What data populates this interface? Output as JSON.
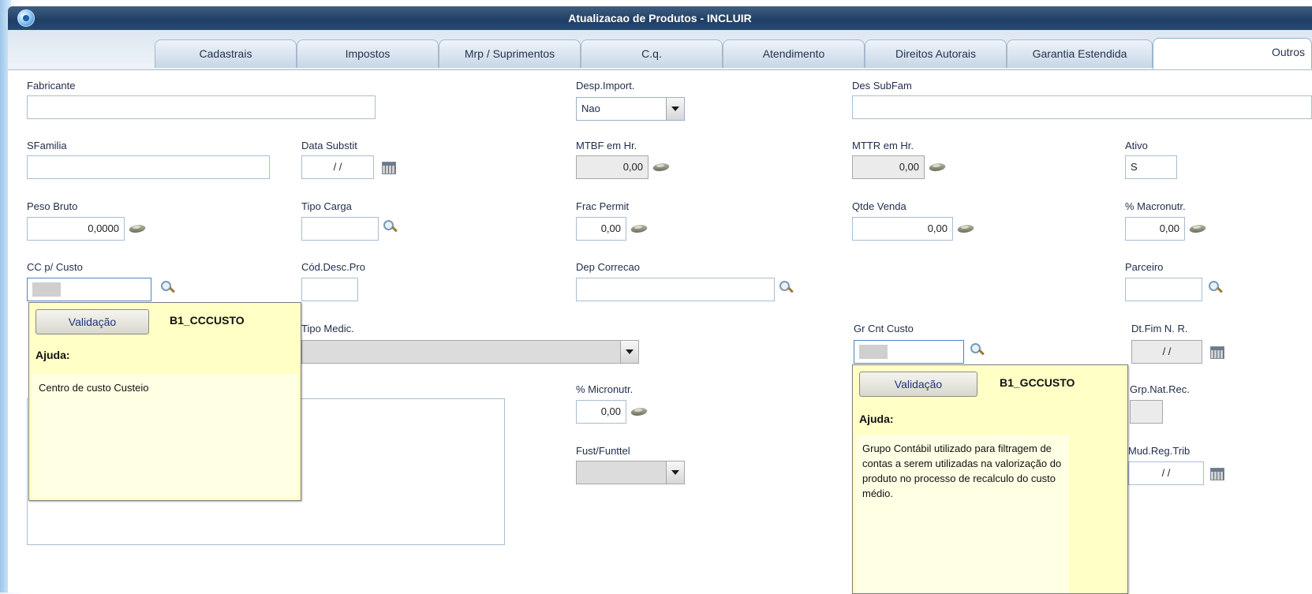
{
  "window": {
    "title": "Atualizacao de Produtos - INCLUIR"
  },
  "tabs": [
    "Cadastrais",
    "Impostos",
    "Mrp / Suprimentos",
    "C.q.",
    "Atendimento",
    "Direitos Autorais",
    "Garantia Estendida",
    "Outros"
  ],
  "active_tab": "Outros",
  "fields": {
    "fabricante": {
      "label": "Fabricante",
      "value": ""
    },
    "desp_import": {
      "label": "Desp.Import.",
      "value": "Nao"
    },
    "des_subfam": {
      "label": "Des SubFam",
      "value": ""
    },
    "sfamilia": {
      "label": "SFamilia",
      "value": ""
    },
    "data_substit": {
      "label": "Data Substit",
      "value": " / /"
    },
    "mtbf": {
      "label": "MTBF em Hr.",
      "value": "0,00"
    },
    "mttr": {
      "label": "MTTR em Hr.",
      "value": "0,00"
    },
    "ativo": {
      "label": "Ativo",
      "value": "S"
    },
    "peso_bruto": {
      "label": "Peso Bruto",
      "value": "0,0000"
    },
    "tipo_carga": {
      "label": "Tipo Carga",
      "value": ""
    },
    "frac_permit": {
      "label": "Frac Permit",
      "value": "0,00"
    },
    "qtde_venda": {
      "label": "Qtde Venda",
      "value": "0,00"
    },
    "macronutr": {
      "label": "% Macronutr.",
      "value": "0,00"
    },
    "cc_custo": {
      "label": "CC p/ Custo",
      "value": ""
    },
    "cod_desc_pro": {
      "label": "Cód.Desc.Pro",
      "value": ""
    },
    "dep_correcao": {
      "label": "Dep Correcao",
      "value": ""
    },
    "parceiro": {
      "label": "Parceiro",
      "value": ""
    },
    "tipo_medic": {
      "label": "Tipo Medic.",
      "value": ""
    },
    "gr_cnt_custo": {
      "label": "Gr Cnt Custo",
      "value": ""
    },
    "dt_fim_nr": {
      "label": "Dt.Fim N. R.",
      "value": " / /"
    },
    "micronutr": {
      "label": "% Micronutr.",
      "value": "0,00"
    },
    "grp_nat_rec": {
      "label": "Grp.Nat.Rec.",
      "value": ""
    },
    "fust_funttel": {
      "label": "Fust/Funttel",
      "value": ""
    },
    "mud_reg_trib": {
      "label": "Mud.Reg.Trib",
      "value": " / /"
    }
  },
  "popups": {
    "cc_custo": {
      "button": "Validação",
      "field": "B1_CCCUSTO",
      "help_label": "Ajuda:",
      "help_text": "Centro de custo Custeio"
    },
    "gr_cnt_custo": {
      "button": "Validação",
      "field": "B1_GCCUSTO",
      "help_label": "Ajuda:",
      "help_text": "Grupo Contábil utilizado para filtragem de contas a serem utilizadas na valorização do produto no processo de recalculo do custo médio."
    }
  }
}
